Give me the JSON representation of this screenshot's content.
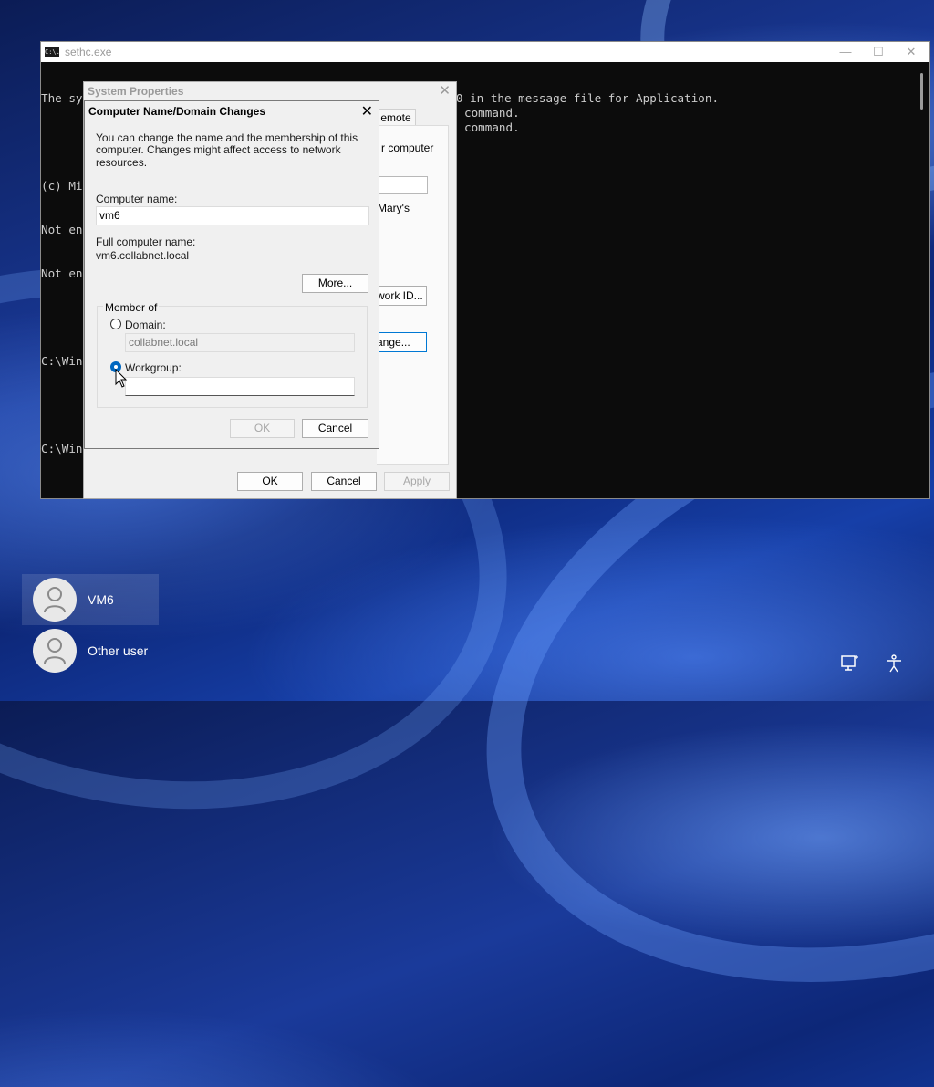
{
  "desktop": {
    "users": [
      {
        "name": "VM6"
      },
      {
        "name": "Other user"
      }
    ],
    "tray": {
      "network_icon": "network-icon",
      "accessibility_icon": "accessibility-icon"
    }
  },
  "console": {
    "title": "sethc.exe",
    "icon_text": "C:\\.",
    "lines": {
      "l1": "The system cannot find message text for message number 0x2350 in the message file for Application.",
      "l2": "",
      "l3": "(c) Mi",
      "l4": "Not en",
      "l5": "Not en",
      "l6": "",
      "l7": "C:\\Win",
      "l8": "",
      "l9": "C:\\Win"
    },
    "right_fragments": {
      "r1": "command.",
      "r2": "command."
    }
  },
  "system_properties": {
    "title": "System Properties",
    "tab_remote": "emote",
    "fragment_computer": "r computer",
    "fragment_marys": "Mary's",
    "fragment_network_id_button": "work ID...",
    "fragment_change_button": "ange...",
    "buttons": {
      "ok": "OK",
      "cancel": "Cancel",
      "apply": "Apply"
    }
  },
  "dialog": {
    "title": "Computer Name/Domain Changes",
    "description_line1": "You can change the name and the membership of this",
    "description_line2": "computer. Changes might affect access to network resources.",
    "computer_name_label": "Computer name:",
    "computer_name_value": "vm6",
    "full_name_label": "Full computer name:",
    "full_name_value": "vm6.collabnet.local",
    "more_button": "More...",
    "member_of_label": "Member of",
    "domain_label": "Domain:",
    "domain_value": "collabnet.local",
    "workgroup_label": "Workgroup:",
    "workgroup_value": "",
    "selected_membership": "workgroup",
    "ok_button": "OK",
    "cancel_button": "Cancel"
  }
}
